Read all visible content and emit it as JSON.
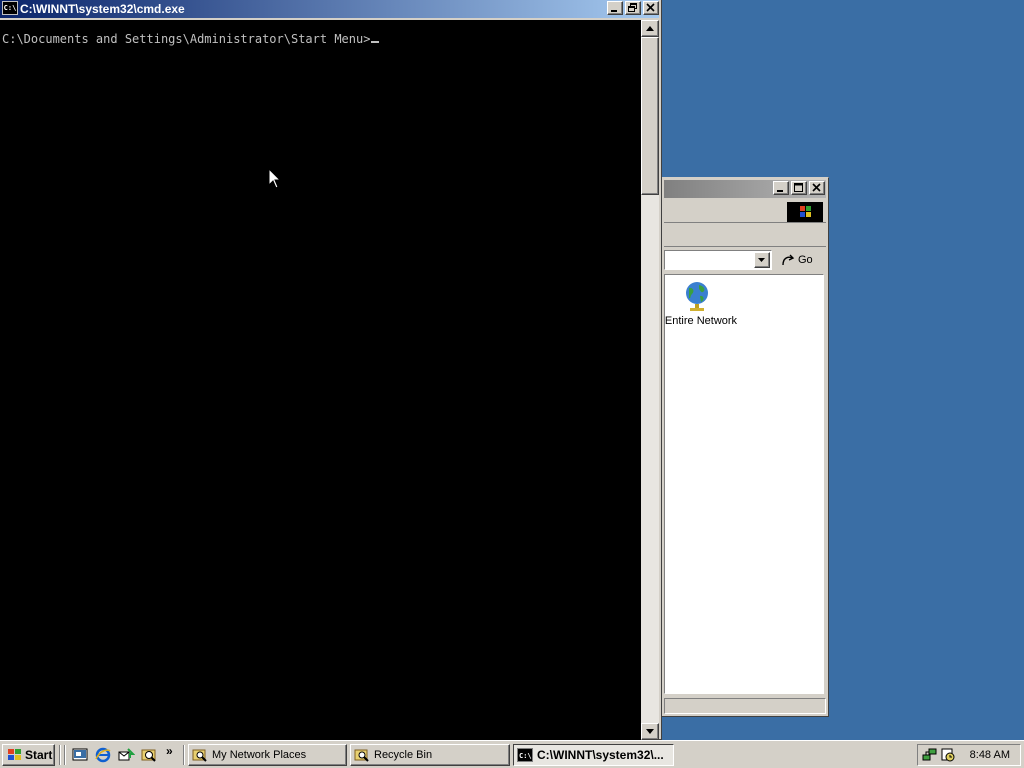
{
  "desktop": {
    "background": "#3a6ea5"
  },
  "cmd_window": {
    "title": "C:\\WINNT\\system32\\cmd.exe",
    "icon_text": "C:\\",
    "prompt": "C:\\Documents and Settings\\Administrator\\Start Menu>"
  },
  "explorer_window": {
    "go_label": "Go",
    "items": [
      {
        "label": "Entire Network",
        "icon": "globe-icon"
      }
    ]
  },
  "taskbar": {
    "start_label": "Start",
    "quick_launch": [
      "show-desktop-icon",
      "internet-explorer-icon",
      "outlook-express-icon",
      "windows-explorer-icon"
    ],
    "chevron": "»",
    "tasks": [
      {
        "label": "My Network Places",
        "active": false
      },
      {
        "label": "Recycle Bin",
        "active": false
      },
      {
        "label": "C:\\WINNT\\system32\\...",
        "active": true
      }
    ],
    "clock": "8:48 AM"
  }
}
